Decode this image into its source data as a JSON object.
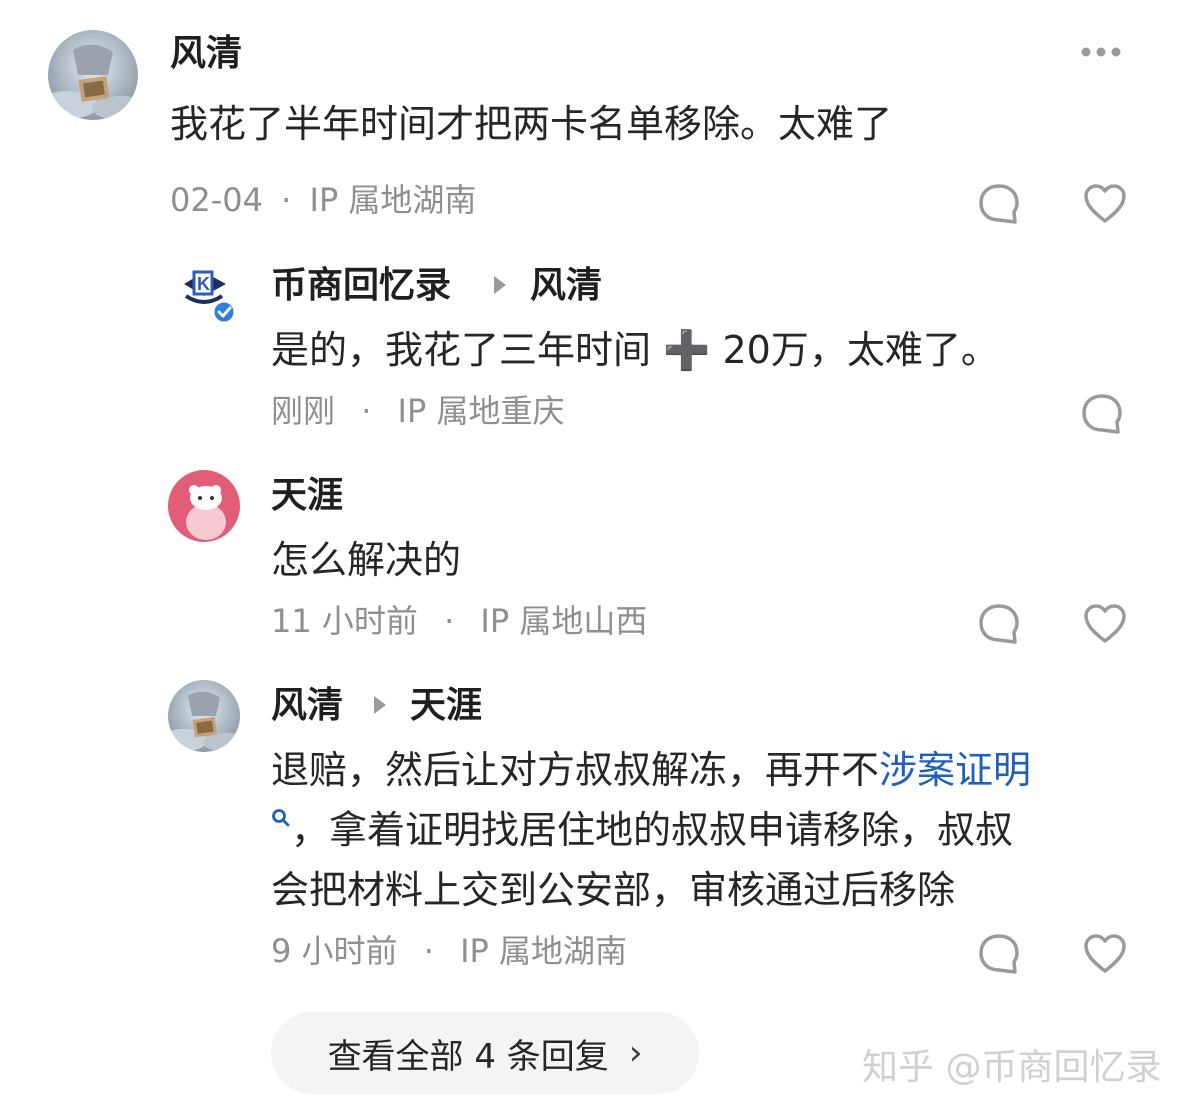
{
  "comments": [
    {
      "author": "风清",
      "text": "我花了半年时间才把两卡名单移除。太难了",
      "time": "02-04",
      "location": "IP 属地湖南"
    },
    {
      "author": "币商回忆录",
      "reply_to": "风清",
      "text": "是的，我花了三年时间 ➕ 20万，太难了。",
      "time": "刚刚",
      "location": "IP 属地重庆"
    },
    {
      "author": "天涯",
      "text": "怎么解决的",
      "time": "11 小时前",
      "location": "IP 属地山西"
    },
    {
      "author": "风清",
      "reply_to": "天涯",
      "text_line1_a": "退赔，然后让对方叔叔解冻，再开不",
      "text_line1_link": "涉案证明",
      "text_line2_b": "，拿着证明找居住地的叔叔申请移除，叔叔",
      "text_line3": "会把材料上交到公安部，审核通过后移除",
      "time": "9 小时前",
      "location": "IP 属地湖南"
    }
  ],
  "separator": "·",
  "view_all_replies": "查看全部 4 条回复",
  "view_all_chevron": "›",
  "watermark": "知乎 @币商回忆录",
  "colors": {
    "link": "#1f5fbf",
    "meta": "#8f8f8f",
    "icon": "#9a9a9a"
  }
}
